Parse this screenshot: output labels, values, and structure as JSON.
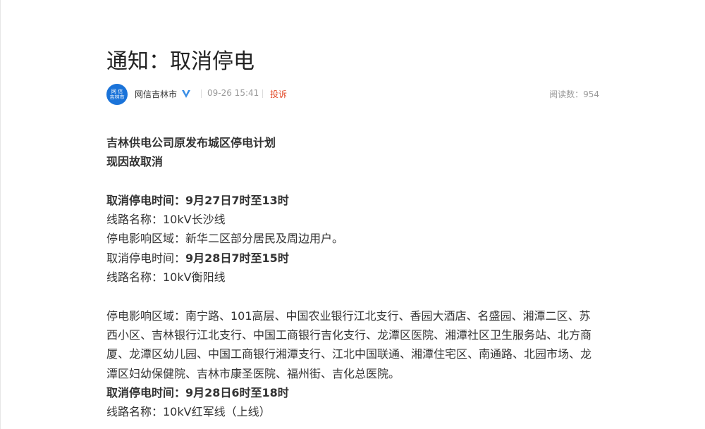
{
  "article": {
    "title": "通知：取消停电",
    "source_name": "网信吉林市",
    "avatar_lines": [
      "网 信",
      "吉林市"
    ],
    "time": "09-26 15:41",
    "report_label": "投诉",
    "reads_label": "阅读数：954"
  },
  "content": {
    "intro_1": "吉林供电公司原发布城区停电计划",
    "intro_2": "现因故取消",
    "cancel_1_time": "取消停电时间：9月27日7时至13时",
    "line_1": "线路名称：10kV长沙线",
    "area_1": "停电影响区域：新华二区部分居民及周边用户。",
    "cancel_2_label": "取消停电时间：",
    "cancel_2_value": "9月28日7时至15时",
    "line_2": "线路名称：10kV衡阳线",
    "area_2": "停电影响区域：南宁路、101高层、中国农业银行江北支行、香园大酒店、名盛园、湘潭二区、苏西小区、吉林银行江北支行、中国工商银行吉化支行、龙潭区医院、湘潭社区卫生服务站、北方商厦、龙潭区幼儿园、中国工商银行湘潭支行、江北中国联通、湘潭住宅区、南通路、北园市场、龙潭区妇幼保健院、吉林市康圣医院、福州街、吉化总医院。",
    "cancel_3_time": "取消停电时间：9月28日6时至18时",
    "line_3": "线路名称：10kV红军线（上线）"
  },
  "colors": {
    "avatar": "#1a73d9",
    "verified": "#3a8ee6",
    "report": "#e24b2a"
  },
  "icons": {
    "verified": "verified-v-icon"
  }
}
